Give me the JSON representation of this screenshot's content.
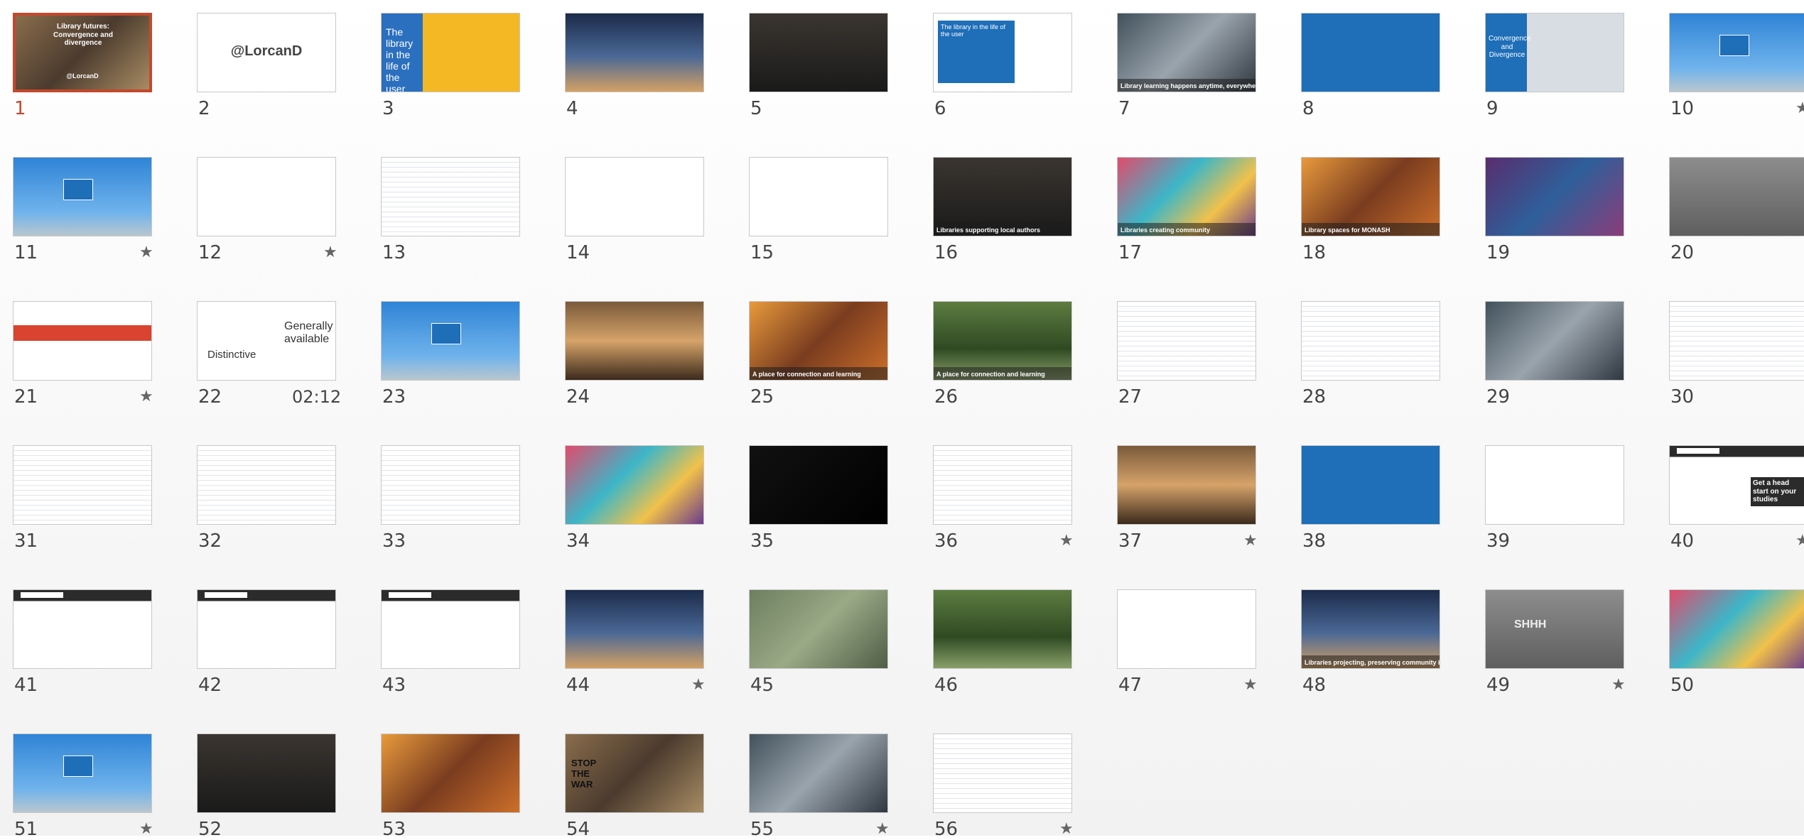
{
  "app": {
    "view": "Slide Sorter"
  },
  "slides": [
    {
      "number": "1",
      "selected": true,
      "star": false,
      "theme": "t-photo",
      "caption": "Library futures: Convergence and divergence",
      "extra": "@LorcanD"
    },
    {
      "number": "2",
      "selected": false,
      "star": false,
      "theme": "t-white",
      "caption": "@LorcanD"
    },
    {
      "number": "3",
      "selected": false,
      "star": false,
      "theme": "t-yellow",
      "caption": "The library in the life of the user"
    },
    {
      "number": "4",
      "selected": false,
      "star": false,
      "theme": "t-night",
      "caption": ""
    },
    {
      "number": "5",
      "selected": false,
      "star": false,
      "theme": "t-dark",
      "caption": ""
    },
    {
      "number": "6",
      "selected": false,
      "star": false,
      "theme": "t-white",
      "caption": "The library in the life of the user"
    },
    {
      "number": "7",
      "selected": false,
      "star": false,
      "theme": "t-photo2",
      "caption": "Library learning happens anytime, everywhere"
    },
    {
      "number": "8",
      "selected": false,
      "star": false,
      "theme": "t-blue",
      "caption": ""
    },
    {
      "number": "9",
      "selected": false,
      "star": false,
      "theme": "t-map",
      "caption": "Convergence and Divergence"
    },
    {
      "number": "10",
      "selected": false,
      "star": true,
      "theme": "t-sky",
      "caption": ""
    },
    {
      "number": "11",
      "selected": false,
      "star": true,
      "theme": "t-sky",
      "caption": ""
    },
    {
      "number": "12",
      "selected": false,
      "star": true,
      "theme": "t-diag",
      "caption": ""
    },
    {
      "number": "13",
      "selected": false,
      "star": false,
      "theme": "t-doc",
      "caption": ""
    },
    {
      "number": "14",
      "selected": false,
      "star": false,
      "theme": "t-diag",
      "caption": ""
    },
    {
      "number": "15",
      "selected": false,
      "star": false,
      "theme": "t-white",
      "caption": ""
    },
    {
      "number": "16",
      "selected": false,
      "star": false,
      "theme": "t-dark",
      "caption": "Libraries supporting local authors"
    },
    {
      "number": "17",
      "selected": false,
      "star": false,
      "theme": "t-colorful",
      "caption": "Libraries creating community"
    },
    {
      "number": "18",
      "selected": false,
      "star": false,
      "theme": "t-warm",
      "caption": "Library spaces for MONASH"
    },
    {
      "number": "19",
      "selected": false,
      "star": false,
      "theme": "t-purple",
      "caption": ""
    },
    {
      "number": "20",
      "selected": false,
      "star": false,
      "theme": "t-grey",
      "caption": ""
    },
    {
      "number": "21",
      "selected": false,
      "star": true,
      "theme": "t-red",
      "caption": ""
    },
    {
      "number": "22",
      "selected": false,
      "star": false,
      "theme": "t-white",
      "caption": "Generally available",
      "extra": "Distinctive",
      "duration": "02:12"
    },
    {
      "number": "23",
      "selected": false,
      "star": false,
      "theme": "t-sky",
      "caption": ""
    },
    {
      "number": "24",
      "selected": false,
      "star": false,
      "theme": "t-library",
      "caption": ""
    },
    {
      "number": "25",
      "selected": false,
      "star": false,
      "theme": "t-warm",
      "caption": "A place for connection and learning"
    },
    {
      "number": "26",
      "selected": false,
      "star": false,
      "theme": "t-green",
      "caption": "A place for connection and learning"
    },
    {
      "number": "27",
      "selected": false,
      "star": false,
      "theme": "t-doc",
      "caption": ""
    },
    {
      "number": "28",
      "selected": false,
      "star": false,
      "theme": "t-doc",
      "caption": ""
    },
    {
      "number": "29",
      "selected": false,
      "star": false,
      "theme": "t-photo2",
      "caption": ""
    },
    {
      "number": "30",
      "selected": false,
      "star": false,
      "theme": "t-doc",
      "caption": ""
    },
    {
      "number": "31",
      "selected": false,
      "star": false,
      "theme": "t-doc",
      "caption": ""
    },
    {
      "number": "32",
      "selected": false,
      "star": false,
      "theme": "t-doc",
      "caption": ""
    },
    {
      "number": "33",
      "selected": false,
      "star": false,
      "theme": "t-doc",
      "caption": ""
    },
    {
      "number": "34",
      "selected": false,
      "star": false,
      "theme": "t-colorful",
      "caption": ""
    },
    {
      "number": "35",
      "selected": false,
      "star": false,
      "theme": "t-black",
      "caption": ""
    },
    {
      "number": "36",
      "selected": false,
      "star": true,
      "theme": "t-doc",
      "caption": ""
    },
    {
      "number": "37",
      "selected": false,
      "star": true,
      "theme": "t-library",
      "caption": ""
    },
    {
      "number": "38",
      "selected": false,
      "star": false,
      "theme": "t-blue",
      "caption": ""
    },
    {
      "number": "39",
      "selected": false,
      "star": false,
      "theme": "t-diag",
      "caption": ""
    },
    {
      "number": "40",
      "selected": false,
      "star": true,
      "theme": "t-web",
      "caption": "Get a head start on your studies"
    },
    {
      "number": "41",
      "selected": false,
      "star": false,
      "theme": "t-web",
      "caption": ""
    },
    {
      "number": "42",
      "selected": false,
      "star": false,
      "theme": "t-web",
      "caption": ""
    },
    {
      "number": "43",
      "selected": false,
      "star": false,
      "theme": "t-web",
      "caption": ""
    },
    {
      "number": "44",
      "selected": false,
      "star": true,
      "theme": "t-night",
      "caption": ""
    },
    {
      "number": "45",
      "selected": false,
      "star": false,
      "theme": "t-aerial",
      "caption": ""
    },
    {
      "number": "46",
      "selected": false,
      "star": false,
      "theme": "t-green",
      "caption": ""
    },
    {
      "number": "47",
      "selected": false,
      "star": true,
      "theme": "t-white",
      "caption": ""
    },
    {
      "number": "48",
      "selected": false,
      "star": false,
      "theme": "t-night",
      "caption": "Libraries projecting, preserving community identity"
    },
    {
      "number": "49",
      "selected": false,
      "star": true,
      "theme": "t-grey",
      "caption": "SHHH"
    },
    {
      "number": "50",
      "selected": false,
      "star": false,
      "theme": "t-colorful",
      "caption": ""
    },
    {
      "number": "51",
      "selected": false,
      "star": true,
      "theme": "t-sky",
      "caption": ""
    },
    {
      "number": "52",
      "selected": false,
      "star": false,
      "theme": "t-dark",
      "caption": ""
    },
    {
      "number": "53",
      "selected": false,
      "star": false,
      "theme": "t-warm",
      "caption": ""
    },
    {
      "number": "54",
      "selected": false,
      "star": false,
      "theme": "t-photo",
      "caption": "STOP THE WAR"
    },
    {
      "number": "55",
      "selected": false,
      "star": true,
      "theme": "t-photo2",
      "caption": ""
    },
    {
      "number": "56",
      "selected": false,
      "star": true,
      "theme": "t-doc",
      "caption": ""
    }
  ],
  "colors": {
    "selected_border": "#c4482c",
    "accent_blue": "#1e6eb8",
    "number_text": "#444444"
  },
  "icons": {
    "star": "star-icon"
  }
}
